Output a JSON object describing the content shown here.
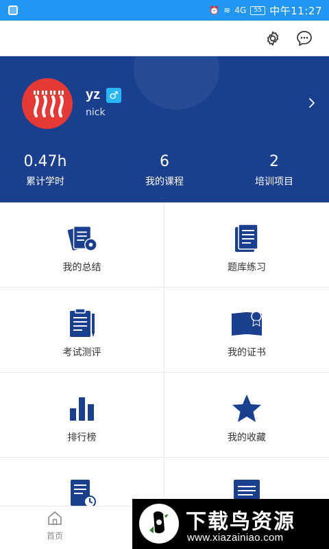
{
  "status_bar": {
    "signal_label": "4G",
    "battery": "55",
    "time": "中午11:27"
  },
  "top_bar": {
    "icons": [
      "settings-icon",
      "message-icon"
    ]
  },
  "profile": {
    "username": "yz",
    "gender_symbol": "♂",
    "nickname": "nick",
    "stats": [
      {
        "value": "0.47h",
        "label": "累计学时"
      },
      {
        "value": "6",
        "label": "我的课程"
      },
      {
        "value": "2",
        "label": "培训项目"
      }
    ]
  },
  "grid": {
    "items": [
      {
        "label": "我的总结",
        "icon": "summary-docs-icon"
      },
      {
        "label": "题库练习",
        "icon": "question-bank-icon"
      },
      {
        "label": "考试测评",
        "icon": "exam-clipboard-icon"
      },
      {
        "label": "我的证书",
        "icon": "certificate-book-icon"
      },
      {
        "label": "排行榜",
        "icon": "ranking-bars-icon"
      },
      {
        "label": "我的收藏",
        "icon": "star-icon"
      },
      {
        "label": "",
        "icon": "history-doc-icon"
      },
      {
        "label": "",
        "icon": "document-icon"
      }
    ]
  },
  "bottom_nav": {
    "home_label": "首页"
  },
  "watermark": {
    "title": "下载鸟资源",
    "url": "www.xiazainiao.com"
  },
  "colors": {
    "status_bar": "#2196f3",
    "profile_bg": "#1a3f8f",
    "icon_primary": "#1a3f8f",
    "avatar": "#e53935",
    "gender_badge": "#29b6f6"
  }
}
